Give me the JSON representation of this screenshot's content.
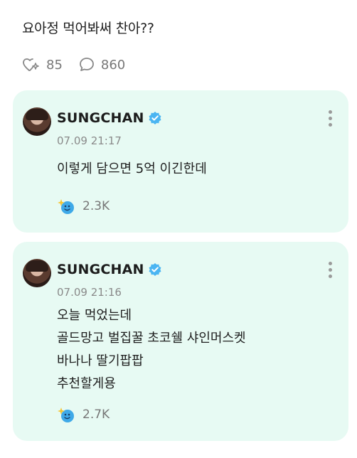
{
  "post": {
    "text": "요아정 먹어봐써 찬아??",
    "likes": "85",
    "comments": "860"
  },
  "replies": [
    {
      "author": "SUNGCHAN",
      "time": "07.09 21:17",
      "lines": [
        "이렇게 담으면 5억 이긴한데"
      ],
      "reaction_count": "2.3K"
    },
    {
      "author": "SUNGCHAN",
      "time": "07.09 21:16",
      "lines": [
        "오늘 먹었는데",
        "골드망고 벌집꿀 초코쉘 샤인머스켓",
        "바나나 딸기팝팝",
        "추천할게용"
      ],
      "reaction_count": "2.7K"
    }
  ],
  "colors": {
    "card_bg": "#e7faf3",
    "verified": "#4bb5f2",
    "muted": "#777777"
  },
  "icons": {
    "like": "sparkle-heart-icon",
    "comment": "speech-bubble-icon",
    "reaction": "blue-emoji-sparkle-icon",
    "verified": "verified-badge-icon",
    "more": "more-vertical-icon"
  }
}
